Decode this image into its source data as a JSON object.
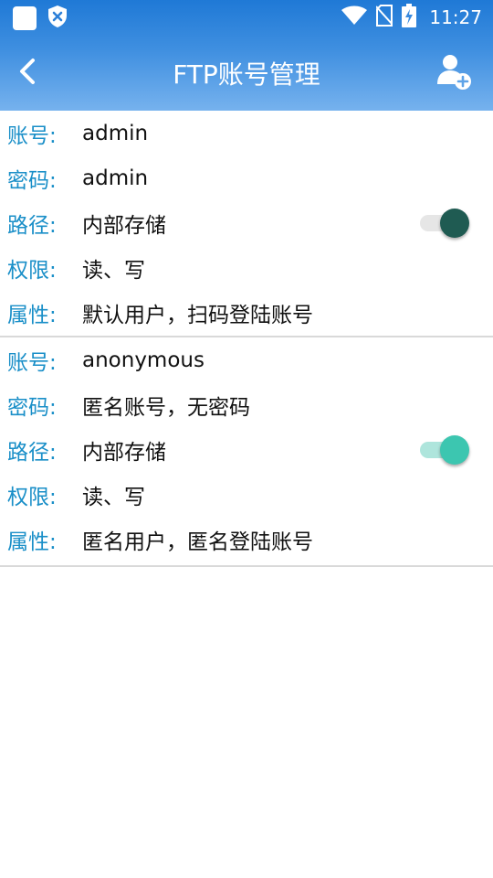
{
  "status_bar": {
    "time": "11:27",
    "icons": [
      "app-square-icon",
      "shield-x-icon",
      "wifi-icon",
      "no-sim-icon",
      "battery-charging-icon"
    ]
  },
  "toolbar": {
    "title": "FTP账号管理",
    "back_icon": "chevron-left-icon",
    "add_icon": "add-user-icon"
  },
  "colors": {
    "label": "#1a8fc8",
    "toggle_thumb_first": "#1f5b52",
    "toggle_track_first": "#e6e6e6",
    "toggle_thumb_second": "#3cc6b0",
    "toggle_track_second": "#aee5dc"
  },
  "accounts": [
    {
      "account_label": "账号:",
      "account": "admin",
      "password_label": "密码:",
      "password": "admin",
      "path_label": "路径:",
      "path": "内部存储",
      "permission_label": "权限:",
      "permission": "读、写",
      "attribute_label": "属性:",
      "attribute": "默认用户，扫码登陆账号",
      "enabled": true
    },
    {
      "account_label": "账号:",
      "account": "anonymous",
      "password_label": "密码:",
      "password": "匿名账号，无密码",
      "path_label": "路径:",
      "path": "内部存储",
      "permission_label": "权限:",
      "permission": "读、写",
      "attribute_label": "属性:",
      "attribute": "匿名用户，匿名登陆账号",
      "enabled": true
    }
  ]
}
